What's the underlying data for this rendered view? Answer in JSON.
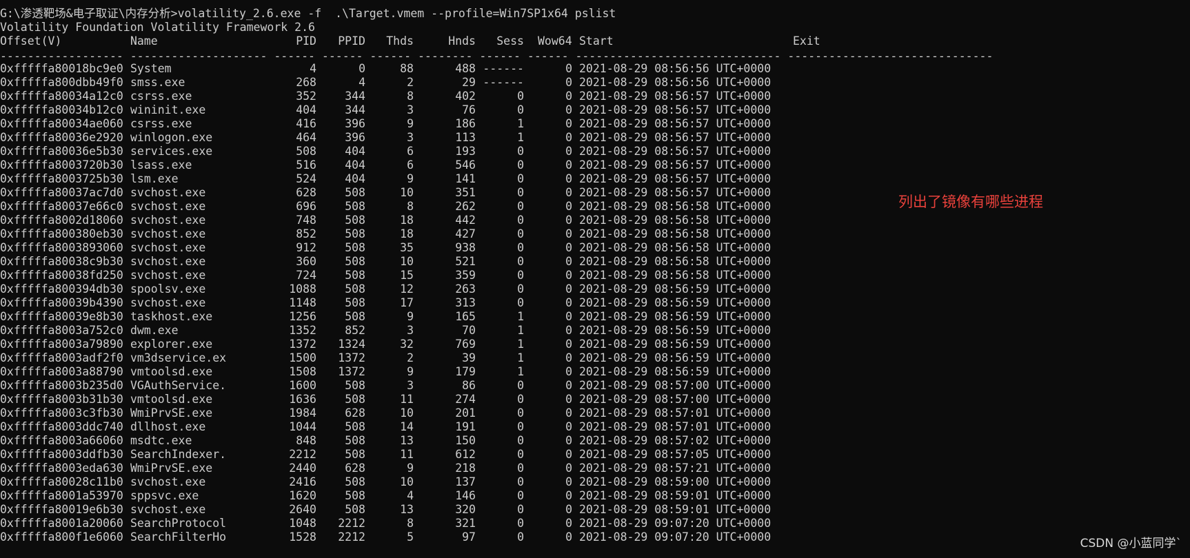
{
  "terminal": {
    "command": "G:\\渗透靶场&电子取证\\内存分析>volatility_2.6.exe -f  .\\Target.vmem --profile=Win7SP1x64 pslist",
    "banner": "Volatility Foundation Volatility Framework 2.6",
    "headers": {
      "offset": "Offset(V)",
      "name": "Name",
      "pid": "PID",
      "ppid": "PPID",
      "thds": "Thds",
      "hnds": "Hnds",
      "sess": "Sess",
      "wow64": "Wow64",
      "start": "Start",
      "exit": "Exit"
    },
    "separator": "------------------ -------------------- ------ ------ ------ -------- ------ ------ ------------------------------ ------------------------------",
    "rows": [
      {
        "offset": "0xfffffa80018bc9e0",
        "name": "System",
        "pid": "4",
        "ppid": "0",
        "thds": "88",
        "hnds": "488",
        "sess": "------",
        "wow64": "0",
        "start": "2021-08-29 08:56:56 UTC+0000"
      },
      {
        "offset": "0xfffffa800dbb49f0",
        "name": "smss.exe",
        "pid": "268",
        "ppid": "4",
        "thds": "2",
        "hnds": "29",
        "sess": "------",
        "wow64": "0",
        "start": "2021-08-29 08:56:56 UTC+0000"
      },
      {
        "offset": "0xfffffa80034a12c0",
        "name": "csrss.exe",
        "pid": "352",
        "ppid": "344",
        "thds": "8",
        "hnds": "402",
        "sess": "0",
        "wow64": "0",
        "start": "2021-08-29 08:56:57 UTC+0000"
      },
      {
        "offset": "0xfffffa80034b12c0",
        "name": "wininit.exe",
        "pid": "404",
        "ppid": "344",
        "thds": "3",
        "hnds": "76",
        "sess": "0",
        "wow64": "0",
        "start": "2021-08-29 08:56:57 UTC+0000"
      },
      {
        "offset": "0xfffffa80034ae060",
        "name": "csrss.exe",
        "pid": "416",
        "ppid": "396",
        "thds": "9",
        "hnds": "186",
        "sess": "1",
        "wow64": "0",
        "start": "2021-08-29 08:56:57 UTC+0000"
      },
      {
        "offset": "0xfffffa80036e2920",
        "name": "winlogon.exe",
        "pid": "464",
        "ppid": "396",
        "thds": "3",
        "hnds": "113",
        "sess": "1",
        "wow64": "0",
        "start": "2021-08-29 08:56:57 UTC+0000"
      },
      {
        "offset": "0xfffffa80036e5b30",
        "name": "services.exe",
        "pid": "508",
        "ppid": "404",
        "thds": "6",
        "hnds": "193",
        "sess": "0",
        "wow64": "0",
        "start": "2021-08-29 08:56:57 UTC+0000"
      },
      {
        "offset": "0xfffffa8003720b30",
        "name": "lsass.exe",
        "pid": "516",
        "ppid": "404",
        "thds": "6",
        "hnds": "546",
        "sess": "0",
        "wow64": "0",
        "start": "2021-08-29 08:56:57 UTC+0000"
      },
      {
        "offset": "0xfffffa8003725b30",
        "name": "lsm.exe",
        "pid": "524",
        "ppid": "404",
        "thds": "9",
        "hnds": "141",
        "sess": "0",
        "wow64": "0",
        "start": "2021-08-29 08:56:57 UTC+0000"
      },
      {
        "offset": "0xfffffa80037ac7d0",
        "name": "svchost.exe",
        "pid": "628",
        "ppid": "508",
        "thds": "10",
        "hnds": "351",
        "sess": "0",
        "wow64": "0",
        "start": "2021-08-29 08:56:57 UTC+0000"
      },
      {
        "offset": "0xfffffa80037e66c0",
        "name": "svchost.exe",
        "pid": "696",
        "ppid": "508",
        "thds": "8",
        "hnds": "262",
        "sess": "0",
        "wow64": "0",
        "start": "2021-08-29 08:56:58 UTC+0000"
      },
      {
        "offset": "0xfffffa8002d18060",
        "name": "svchost.exe",
        "pid": "748",
        "ppid": "508",
        "thds": "18",
        "hnds": "442",
        "sess": "0",
        "wow64": "0",
        "start": "2021-08-29 08:56:58 UTC+0000"
      },
      {
        "offset": "0xfffffa800380eb30",
        "name": "svchost.exe",
        "pid": "852",
        "ppid": "508",
        "thds": "18",
        "hnds": "427",
        "sess": "0",
        "wow64": "0",
        "start": "2021-08-29 08:56:58 UTC+0000"
      },
      {
        "offset": "0xfffffa8003893060",
        "name": "svchost.exe",
        "pid": "912",
        "ppid": "508",
        "thds": "35",
        "hnds": "938",
        "sess": "0",
        "wow64": "0",
        "start": "2021-08-29 08:56:58 UTC+0000"
      },
      {
        "offset": "0xfffffa80038c9b30",
        "name": "svchost.exe",
        "pid": "360",
        "ppid": "508",
        "thds": "10",
        "hnds": "521",
        "sess": "0",
        "wow64": "0",
        "start": "2021-08-29 08:56:58 UTC+0000"
      },
      {
        "offset": "0xfffffa80038fd250",
        "name": "svchost.exe",
        "pid": "724",
        "ppid": "508",
        "thds": "15",
        "hnds": "359",
        "sess": "0",
        "wow64": "0",
        "start": "2021-08-29 08:56:58 UTC+0000"
      },
      {
        "offset": "0xfffffa800394db30",
        "name": "spoolsv.exe",
        "pid": "1088",
        "ppid": "508",
        "thds": "12",
        "hnds": "263",
        "sess": "0",
        "wow64": "0",
        "start": "2021-08-29 08:56:59 UTC+0000"
      },
      {
        "offset": "0xfffffa80039b4390",
        "name": "svchost.exe",
        "pid": "1148",
        "ppid": "508",
        "thds": "17",
        "hnds": "313",
        "sess": "0",
        "wow64": "0",
        "start": "2021-08-29 08:56:59 UTC+0000"
      },
      {
        "offset": "0xfffffa80039e8b30",
        "name": "taskhost.exe",
        "pid": "1256",
        "ppid": "508",
        "thds": "9",
        "hnds": "165",
        "sess": "1",
        "wow64": "0",
        "start": "2021-08-29 08:56:59 UTC+0000"
      },
      {
        "offset": "0xfffffa8003a752c0",
        "name": "dwm.exe",
        "pid": "1352",
        "ppid": "852",
        "thds": "3",
        "hnds": "70",
        "sess": "1",
        "wow64": "0",
        "start": "2021-08-29 08:56:59 UTC+0000"
      },
      {
        "offset": "0xfffffa8003a79890",
        "name": "explorer.exe",
        "pid": "1372",
        "ppid": "1324",
        "thds": "32",
        "hnds": "769",
        "sess": "1",
        "wow64": "0",
        "start": "2021-08-29 08:56:59 UTC+0000"
      },
      {
        "offset": "0xfffffa8003adf2f0",
        "name": "vm3dservice.ex",
        "pid": "1500",
        "ppid": "1372",
        "thds": "2",
        "hnds": "39",
        "sess": "1",
        "wow64": "0",
        "start": "2021-08-29 08:56:59 UTC+0000"
      },
      {
        "offset": "0xfffffa8003a88790",
        "name": "vmtoolsd.exe",
        "pid": "1508",
        "ppid": "1372",
        "thds": "9",
        "hnds": "179",
        "sess": "1",
        "wow64": "0",
        "start": "2021-08-29 08:56:59 UTC+0000"
      },
      {
        "offset": "0xfffffa8003b235d0",
        "name": "VGAuthService.",
        "pid": "1600",
        "ppid": "508",
        "thds": "3",
        "hnds": "86",
        "sess": "0",
        "wow64": "0",
        "start": "2021-08-29 08:57:00 UTC+0000"
      },
      {
        "offset": "0xfffffa8003b31b30",
        "name": "vmtoolsd.exe",
        "pid": "1636",
        "ppid": "508",
        "thds": "11",
        "hnds": "274",
        "sess": "0",
        "wow64": "0",
        "start": "2021-08-29 08:57:00 UTC+0000"
      },
      {
        "offset": "0xfffffa8003c3fb30",
        "name": "WmiPrvSE.exe",
        "pid": "1984",
        "ppid": "628",
        "thds": "10",
        "hnds": "201",
        "sess": "0",
        "wow64": "0",
        "start": "2021-08-29 08:57:01 UTC+0000"
      },
      {
        "offset": "0xfffffa8003ddc740",
        "name": "dllhost.exe",
        "pid": "1044",
        "ppid": "508",
        "thds": "14",
        "hnds": "191",
        "sess": "0",
        "wow64": "0",
        "start": "2021-08-29 08:57:01 UTC+0000"
      },
      {
        "offset": "0xfffffa8003a66060",
        "name": "msdtc.exe",
        "pid": "848",
        "ppid": "508",
        "thds": "13",
        "hnds": "150",
        "sess": "0",
        "wow64": "0",
        "start": "2021-08-29 08:57:02 UTC+0000"
      },
      {
        "offset": "0xfffffa8003ddfb30",
        "name": "SearchIndexer.",
        "pid": "2212",
        "ppid": "508",
        "thds": "11",
        "hnds": "612",
        "sess": "0",
        "wow64": "0",
        "start": "2021-08-29 08:57:05 UTC+0000"
      },
      {
        "offset": "0xfffffa8003eda630",
        "name": "WmiPrvSE.exe",
        "pid": "2440",
        "ppid": "628",
        "thds": "9",
        "hnds": "218",
        "sess": "0",
        "wow64": "0",
        "start": "2021-08-29 08:57:21 UTC+0000"
      },
      {
        "offset": "0xfffffa80028c11b0",
        "name": "svchost.exe",
        "pid": "2416",
        "ppid": "508",
        "thds": "10",
        "hnds": "137",
        "sess": "0",
        "wow64": "0",
        "start": "2021-08-29 08:59:00 UTC+0000"
      },
      {
        "offset": "0xfffffa8001a53970",
        "name": "sppsvc.exe",
        "pid": "1620",
        "ppid": "508",
        "thds": "4",
        "hnds": "146",
        "sess": "0",
        "wow64": "0",
        "start": "2021-08-29 08:59:01 UTC+0000"
      },
      {
        "offset": "0xfffffa80019e6b30",
        "name": "svchost.exe",
        "pid": "2640",
        "ppid": "508",
        "thds": "13",
        "hnds": "320",
        "sess": "0",
        "wow64": "0",
        "start": "2021-08-29 08:59:01 UTC+0000"
      },
      {
        "offset": "0xfffffa8001a20060",
        "name": "SearchProtocol",
        "pid": "1048",
        "ppid": "2212",
        "thds": "8",
        "hnds": "321",
        "sess": "0",
        "wow64": "0",
        "start": "2021-08-29 09:07:20 UTC+0000"
      },
      {
        "offset": "0xfffffa800f1e6060",
        "name": "SearchFilterHo",
        "pid": "1528",
        "ppid": "2212",
        "thds": "5",
        "hnds": "97",
        "sess": "0",
        "wow64": "0",
        "start": "2021-08-29 09:07:20 UTC+0000"
      }
    ]
  },
  "annotation": {
    "text": "列出了镜像有哪些进程",
    "color": "#e8413b"
  },
  "watermark": {
    "text": "CSDN @小蓝同学`"
  },
  "colors": {
    "background": "#0c0c0c",
    "foreground": "#cccccc"
  }
}
